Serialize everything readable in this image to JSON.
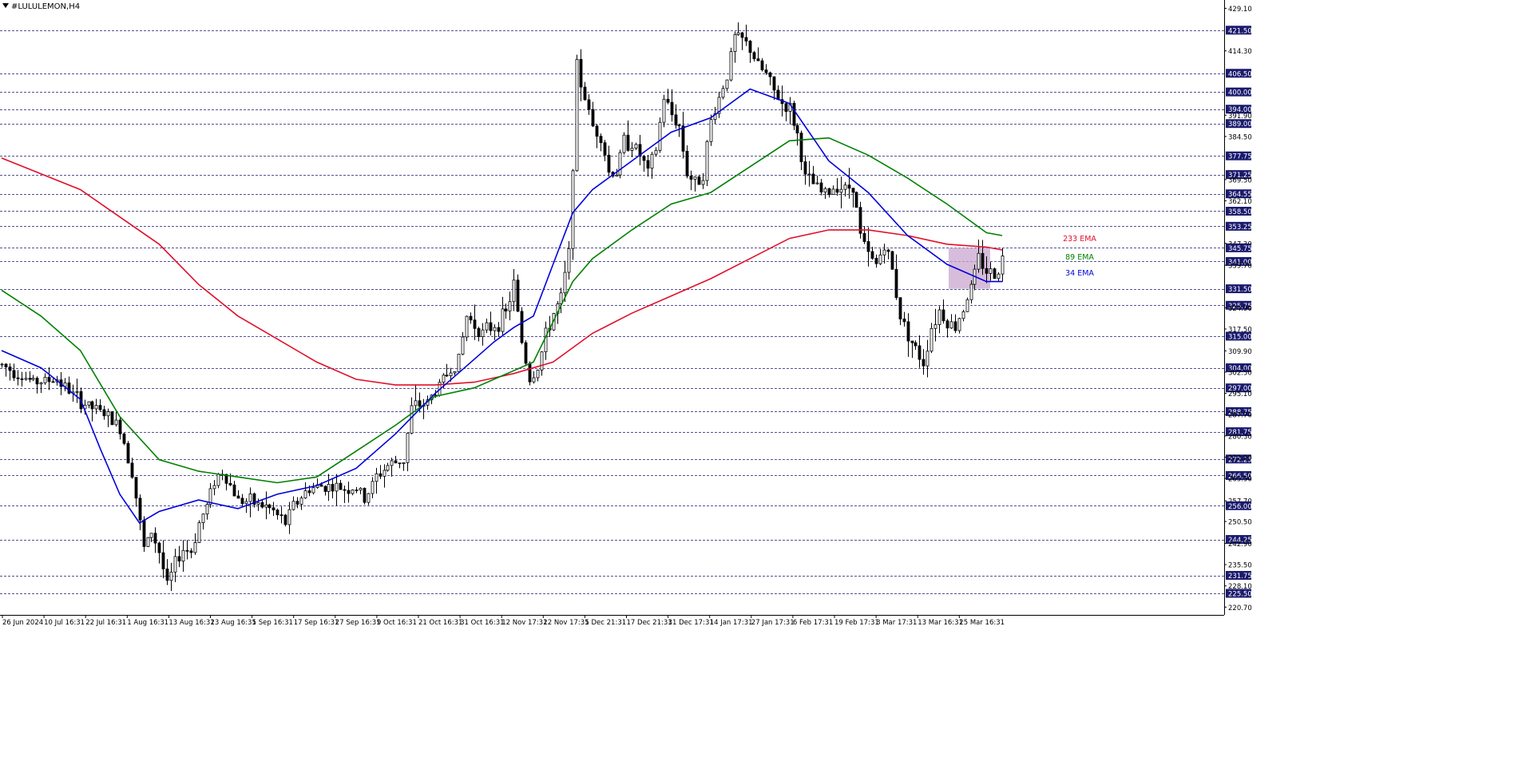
{
  "window": {
    "symbol_title": "#LULULEMON,H4"
  },
  "chart_data": {
    "type": "candlestick",
    "title": "#LULULEMON,H4",
    "ylim": [
      218.0,
      432.0
    ],
    "y_ticks": [
      "429.10",
      "421.50",
      "414.30",
      "406.50",
      "400.00",
      "394.00",
      "391.90",
      "389.00",
      "384.50",
      "377.75",
      "371.25",
      "369.50",
      "364.55",
      "362.10",
      "358.50",
      "353.25",
      "347.30",
      "345.75",
      "341.00",
      "339.70",
      "331.50",
      "325.75",
      "324.90",
      "317.50",
      "315.00",
      "309.90",
      "304.00",
      "302.50",
      "297.00",
      "295.10",
      "288.75",
      "287.70",
      "281.75",
      "280.30",
      "272.25",
      "272.90",
      "266.50",
      "265.50",
      "257.70",
      "256.00",
      "250.50",
      "244.25",
      "242.90",
      "235.50",
      "231.75",
      "228.10",
      "225.50",
      "220.70"
    ],
    "highlighted_levels": [
      "421.50",
      "406.50",
      "400.00",
      "394.00",
      "389.00",
      "377.75",
      "371.25",
      "364.55",
      "358.50",
      "353.25",
      "345.75",
      "341.00",
      "331.50",
      "325.75",
      "315.00",
      "304.00",
      "297.00",
      "288.75",
      "281.75",
      "272.25",
      "266.50",
      "256.00",
      "244.25",
      "231.75",
      "225.50"
    ],
    "x_labels": [
      "26 Jun 2024",
      "10 Jul 16:31",
      "22 Jul 16:31",
      "1 Aug 16:31",
      "13 Aug 16:31",
      "23 Aug 16:31",
      "5 Sep 16:31",
      "17 Sep 16:31",
      "27 Sep 16:31",
      "9 Oct 16:31",
      "21 Oct 16:31",
      "31 Oct 16:31",
      "12 Nov 17:31",
      "22 Nov 17:31",
      "5 Dec 21:31",
      "17 Dec 21:31",
      "31 Dec 17:31",
      "14 Jan 17:31",
      "27 Jan 17:31",
      "6 Feb 17:31",
      "19 Feb 17:31",
      "3 Mar 17:31",
      "13 Mar 16:31",
      "25 Mar 16:31"
    ],
    "price_path": [
      [
        0,
        305
      ],
      [
        8,
        299
      ],
      [
        14,
        300
      ],
      [
        20,
        292
      ],
      [
        26,
        288
      ],
      [
        30,
        283
      ],
      [
        33,
        268
      ],
      [
        36,
        241
      ],
      [
        38,
        247
      ],
      [
        40,
        240
      ],
      [
        42,
        228
      ],
      [
        44,
        236
      ],
      [
        46,
        241
      ],
      [
        48,
        240
      ],
      [
        50,
        250
      ],
      [
        52,
        256
      ],
      [
        54,
        265
      ],
      [
        56,
        268
      ],
      [
        60,
        258
      ],
      [
        64,
        257
      ],
      [
        68,
        255
      ],
      [
        72,
        250
      ],
      [
        74,
        256
      ],
      [
        78,
        262
      ],
      [
        82,
        263
      ],
      [
        86,
        262
      ],
      [
        90,
        262
      ],
      [
        92,
        258
      ],
      [
        95,
        266
      ],
      [
        98,
        270
      ],
      [
        102,
        272
      ],
      [
        104,
        290
      ],
      [
        108,
        292
      ],
      [
        112,
        300
      ],
      [
        116,
        307
      ],
      [
        118,
        322
      ],
      [
        122,
        316
      ],
      [
        126,
        320
      ],
      [
        128,
        323
      ],
      [
        130,
        333
      ],
      [
        132,
        313
      ],
      [
        134,
        300
      ],
      [
        136,
        304
      ],
      [
        138,
        315
      ],
      [
        140,
        323
      ],
      [
        142,
        328
      ],
      [
        144,
        344
      ],
      [
        146,
        408
      ],
      [
        148,
        398
      ],
      [
        150,
        388
      ],
      [
        152,
        385
      ],
      [
        154,
        372
      ],
      [
        156,
        372
      ],
      [
        158,
        383
      ],
      [
        160,
        382
      ],
      [
        162,
        378
      ],
      [
        164,
        372
      ],
      [
        166,
        380
      ],
      [
        168,
        398
      ],
      [
        170,
        392
      ],
      [
        172,
        388
      ],
      [
        174,
        372
      ],
      [
        176,
        368
      ],
      [
        178,
        372
      ],
      [
        180,
        390
      ],
      [
        182,
        398
      ],
      [
        184,
        406
      ],
      [
        186,
        419
      ],
      [
        188,
        418
      ],
      [
        190,
        415
      ],
      [
        192,
        409
      ],
      [
        194,
        406
      ],
      [
        196,
        400
      ],
      [
        198,
        396
      ],
      [
        200,
        394
      ],
      [
        202,
        385
      ],
      [
        204,
        370
      ],
      [
        206,
        368
      ],
      [
        208,
        365
      ],
      [
        210,
        365
      ],
      [
        212,
        368
      ],
      [
        214,
        366
      ],
      [
        216,
        368
      ],
      [
        218,
        350
      ],
      [
        220,
        343
      ],
      [
        222,
        340
      ],
      [
        224,
        347
      ],
      [
        226,
        338
      ],
      [
        228,
        322
      ],
      [
        230,
        316
      ],
      [
        232,
        310
      ],
      [
        234,
        306
      ],
      [
        236,
        318
      ],
      [
        238,
        324
      ],
      [
        240,
        320
      ],
      [
        242,
        318
      ],
      [
        244,
        325
      ],
      [
        246,
        332
      ],
      [
        248,
        342
      ],
      [
        250,
        338
      ],
      [
        252,
        336
      ],
      [
        254,
        342
      ]
    ],
    "series": [
      {
        "name": "233 EMA",
        "color": "#e0102a",
        "values": [
          [
            0,
            377
          ],
          [
            20,
            366
          ],
          [
            40,
            347
          ],
          [
            50,
            333
          ],
          [
            60,
            322
          ],
          [
            70,
            314
          ],
          [
            80,
            306
          ],
          [
            90,
            300
          ],
          [
            100,
            298
          ],
          [
            110,
            298
          ],
          [
            120,
            299
          ],
          [
            130,
            302
          ],
          [
            140,
            306
          ],
          [
            150,
            316
          ],
          [
            160,
            323
          ],
          [
            170,
            329
          ],
          [
            180,
            335
          ],
          [
            190,
            342
          ],
          [
            200,
            349
          ],
          [
            210,
            352
          ],
          [
            220,
            352
          ],
          [
            230,
            350
          ],
          [
            240,
            347
          ],
          [
            250,
            346
          ],
          [
            254,
            345
          ]
        ]
      },
      {
        "name": "89 EMA",
        "color": "#008000",
        "values": [
          [
            0,
            331
          ],
          [
            10,
            322
          ],
          [
            20,
            310
          ],
          [
            30,
            287
          ],
          [
            40,
            272
          ],
          [
            50,
            268
          ],
          [
            60,
            266
          ],
          [
            70,
            264
          ],
          [
            80,
            266
          ],
          [
            90,
            275
          ],
          [
            100,
            284
          ],
          [
            110,
            294
          ],
          [
            120,
            297
          ],
          [
            130,
            303
          ],
          [
            135,
            306
          ],
          [
            140,
            320
          ],
          [
            145,
            334
          ],
          [
            150,
            342
          ],
          [
            160,
            352
          ],
          [
            170,
            361
          ],
          [
            180,
            365
          ],
          [
            190,
            374
          ],
          [
            200,
            383
          ],
          [
            210,
            384
          ],
          [
            220,
            378
          ],
          [
            230,
            370
          ],
          [
            240,
            361
          ],
          [
            250,
            351
          ],
          [
            254,
            350
          ]
        ]
      },
      {
        "name": "34 EMA",
        "color": "#0000dd",
        "values": [
          [
            0,
            310
          ],
          [
            10,
            304
          ],
          [
            20,
            293
          ],
          [
            25,
            276
          ],
          [
            30,
            260
          ],
          [
            35,
            250
          ],
          [
            40,
            254
          ],
          [
            50,
            258
          ],
          [
            60,
            255
          ],
          [
            70,
            260
          ],
          [
            80,
            263
          ],
          [
            90,
            269
          ],
          [
            100,
            281
          ],
          [
            110,
            295
          ],
          [
            120,
            307
          ],
          [
            125,
            313
          ],
          [
            130,
            318
          ],
          [
            135,
            322
          ],
          [
            140,
            340
          ],
          [
            145,
            358
          ],
          [
            150,
            366
          ],
          [
            160,
            376
          ],
          [
            170,
            386
          ],
          [
            180,
            391
          ],
          [
            190,
            401
          ],
          [
            200,
            396
          ],
          [
            210,
            376
          ],
          [
            220,
            365
          ],
          [
            230,
            350
          ],
          [
            240,
            340
          ],
          [
            250,
            334
          ],
          [
            254,
            334
          ]
        ]
      }
    ],
    "legend": [
      {
        "label": "233 EMA",
        "color": "#e0102a"
      },
      {
        "label": "89 EMA",
        "color": "#008000"
      },
      {
        "label": "34 EMA",
        "color": "#0000dd"
      }
    ],
    "zone": {
      "y_top": 345.75,
      "y_bottom": 331.5,
      "color": "#c9a7cf"
    },
    "grid": false
  }
}
